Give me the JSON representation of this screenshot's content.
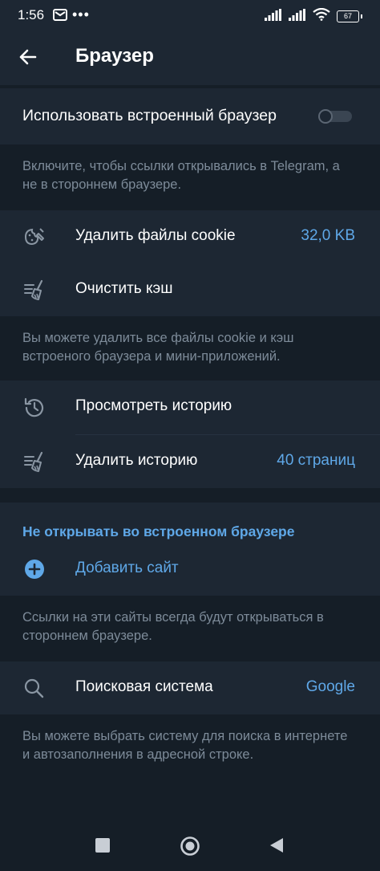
{
  "status_bar": {
    "time": "1:56",
    "dots": "•••",
    "battery": "67",
    "icons": [
      "mail-icon",
      "signal-icon",
      "signal-icon",
      "wifi-icon",
      "battery-icon"
    ]
  },
  "app_bar": {
    "title": "Браузер",
    "back_icon": "arrow-left-icon"
  },
  "in_app_browser": {
    "label": "Использовать встроенный браузер",
    "enabled": false,
    "info": "Включите, чтобы ссылки открывались в Telegram, а не в стороннем браузере."
  },
  "data_section": {
    "cookies": {
      "label": "Удалить файлы cookie",
      "value": "32,0 KB",
      "icon": "cookie-icon"
    },
    "cache": {
      "label": "Очистить кэш",
      "icon": "broom-icon"
    },
    "info": "Вы можете удалить все файлы cookie и кэш встроеного браузера и мини-приложений."
  },
  "history_section": {
    "view": {
      "label": "Просмотреть историю",
      "icon": "history-icon"
    },
    "clear": {
      "label": "Удалить историю",
      "value": "40 страниц",
      "icon": "broom-icon"
    }
  },
  "exceptions_section": {
    "title": "Не открывать во встроенном браузере",
    "add": {
      "label": "Добавить сайт",
      "icon": "plus-circle-icon"
    },
    "info": "Ссылки на эти сайты всегда будут открываться в стороннем браузере."
  },
  "search_section": {
    "engine": {
      "label": "Поисковая система",
      "value": "Google",
      "icon": "search-icon"
    },
    "info": "Вы можете выбрать систему для поиска в интернете и автозаполнения в адресной строке."
  },
  "colors": {
    "background": "#151e27",
    "surface": "#1d2733",
    "accent": "#5fa8e8",
    "secondary_text": "#7d8b99"
  }
}
